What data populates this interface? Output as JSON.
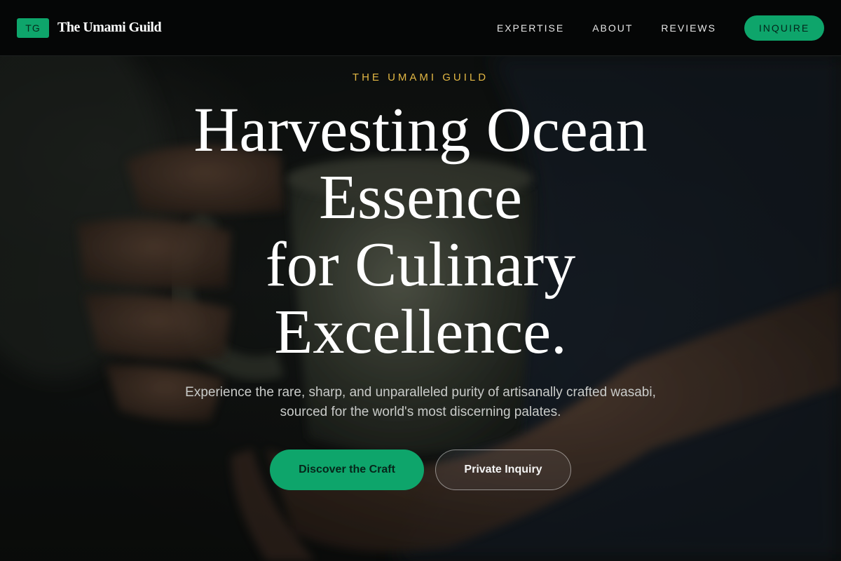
{
  "header": {
    "logo_badge": "TG",
    "brand_name": "The Umami Guild",
    "nav": [
      {
        "label": "EXPERTISE"
      },
      {
        "label": "ABOUT"
      },
      {
        "label": "REVIEWS"
      }
    ],
    "cta_label": "INQUIRE"
  },
  "hero": {
    "eyebrow": "THE UMAMI GUILD",
    "headline_lines": [
      "Harvesting Ocean",
      "Essence",
      "for Culinary",
      "Excellence."
    ],
    "subtitle": "Experience the rare, sharp, and unparalleled purity of artisanally crafted wasabi, sourced for the world's most discerning palates.",
    "primary_cta": "Discover the Craft",
    "secondary_cta": "Private Inquiry"
  },
  "colors": {
    "accent_green": "#0ea56b",
    "eyebrow_gold": "#e2b744",
    "header_bg": "#050606"
  }
}
